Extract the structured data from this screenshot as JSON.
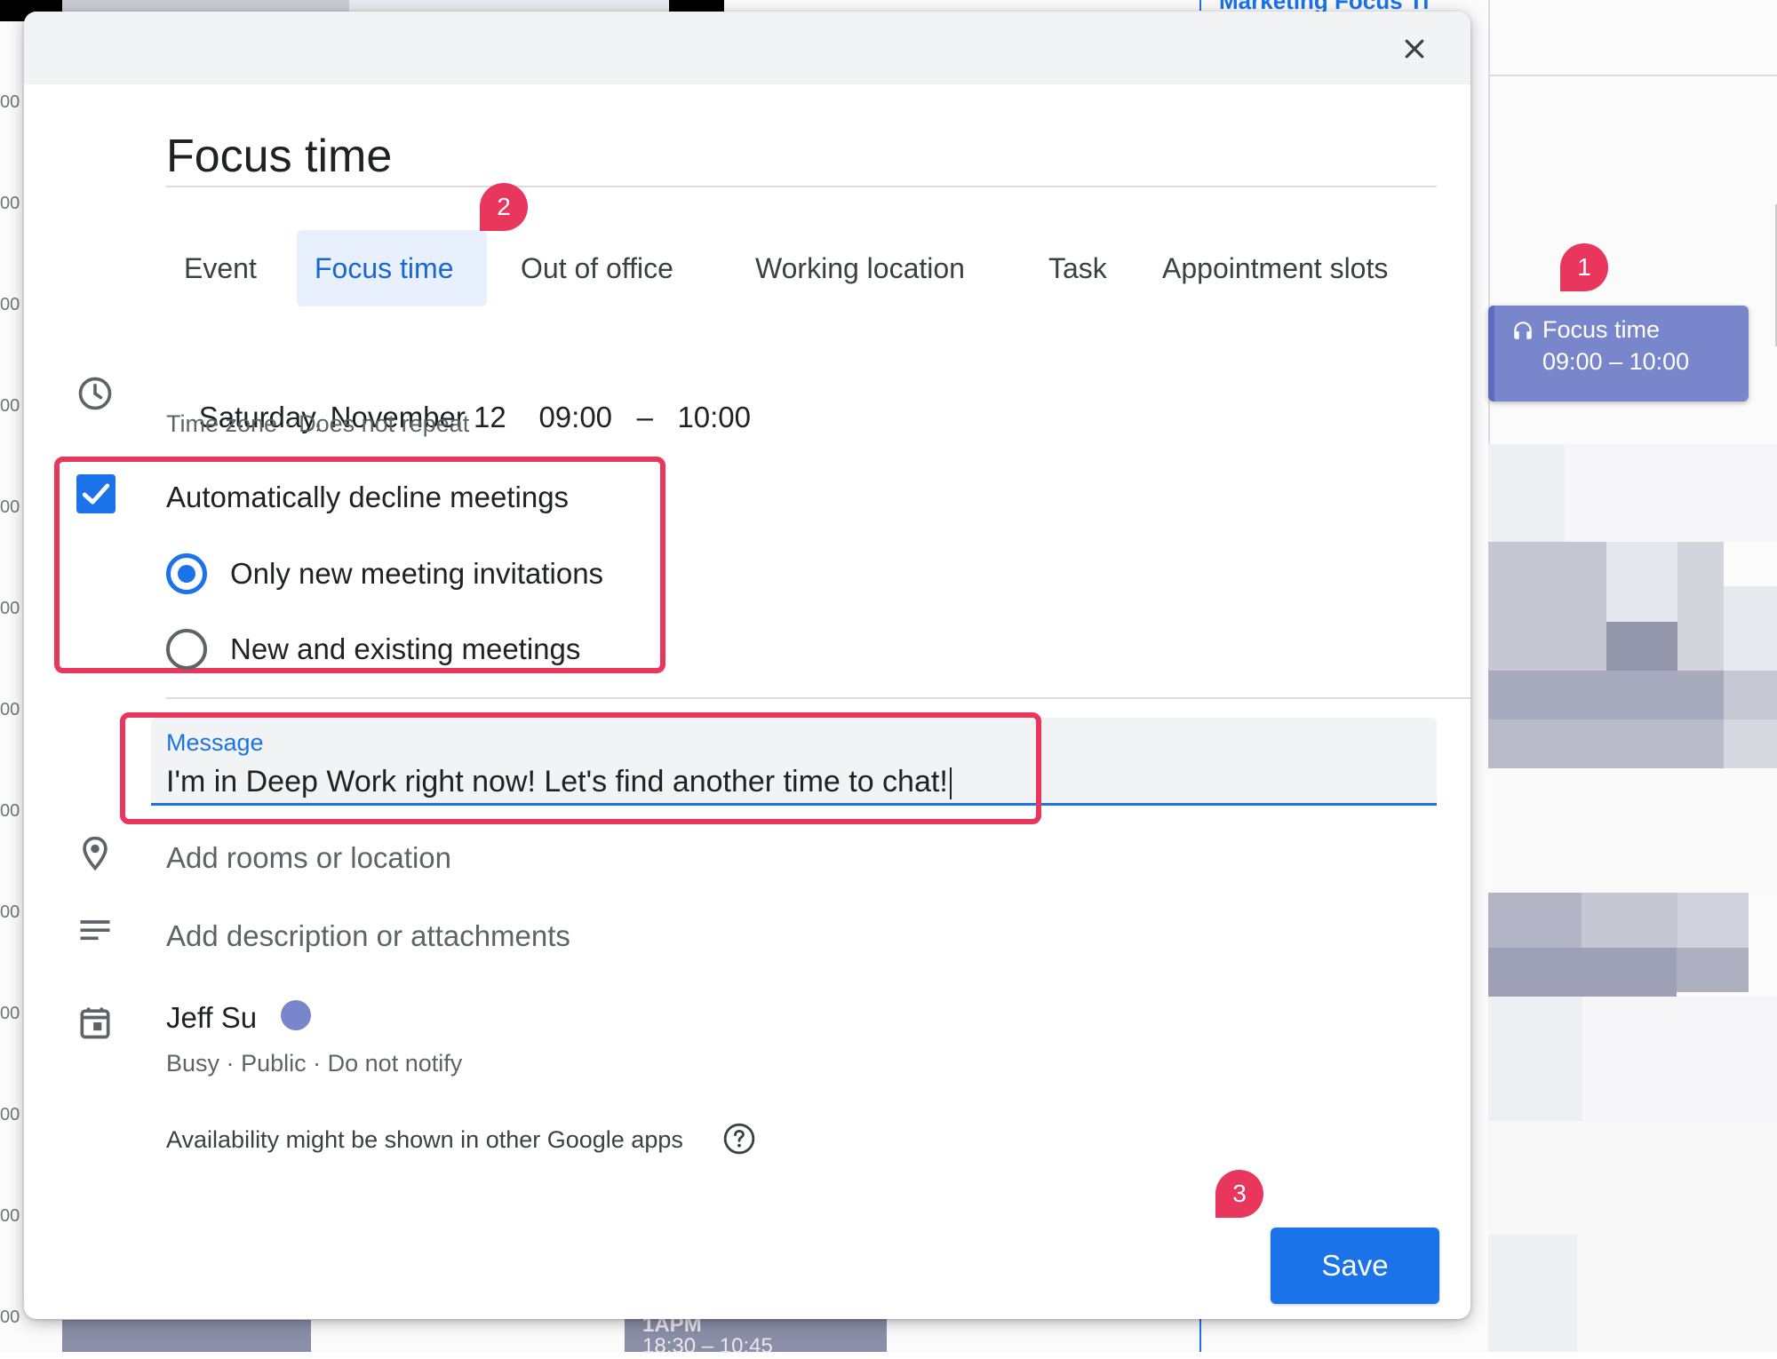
{
  "background": {
    "hour_label_fragment": "00",
    "top_link_fragment": "Marketing Focus Ti",
    "bottom_event_fragment_1": "1APM",
    "bottom_event_fragment_2": "18:30 – 10:45",
    "event_chip": {
      "icon": "headphones-icon",
      "title": "Focus time",
      "time": "09:00 – 10:00",
      "color": "#7986cb"
    }
  },
  "dialog": {
    "close_icon": "close-icon",
    "title": "Focus time",
    "tabs": [
      {
        "label": "Event",
        "active": false
      },
      {
        "label": "Focus time",
        "active": true
      },
      {
        "label": "Out of office",
        "active": false
      },
      {
        "label": "Working location",
        "active": false
      },
      {
        "label": "Task",
        "active": false
      },
      {
        "label": "Appointment slots",
        "active": false
      }
    ],
    "datetime": {
      "icon": "clock-icon",
      "date": "Saturday, November 12",
      "start": "09:00",
      "separator": "–",
      "end": "10:00",
      "timezone": "Time zone",
      "dot": "·",
      "repeat": "Does not repeat"
    },
    "decline": {
      "checked": true,
      "label": "Automatically decline meetings",
      "options": [
        {
          "label": "Only new meeting invitations",
          "selected": true
        },
        {
          "label": "New and existing meetings",
          "selected": false
        }
      ]
    },
    "message": {
      "label": "Message",
      "value": "I'm in Deep Work right now! Let's find another time to chat!"
    },
    "location": {
      "icon": "location-pin-icon",
      "placeholder": "Add rooms or location"
    },
    "description": {
      "icon": "notes-icon",
      "placeholder": "Add description or attachments"
    },
    "calendar": {
      "icon": "calendar-icon",
      "owner": "Jeff Su",
      "color": "#7986cb",
      "status": "Busy",
      "visibility": "Public",
      "notify": "Do not notify",
      "dot": "·"
    },
    "availability_note": "Availability might be shown in other Google apps",
    "help_icon": "help-circle-icon",
    "save_label": "Save",
    "accent_color": "#1a73e8"
  },
  "annotations": {
    "highlight_color": "#e8365d",
    "badges": [
      "1",
      "2",
      "3"
    ]
  }
}
